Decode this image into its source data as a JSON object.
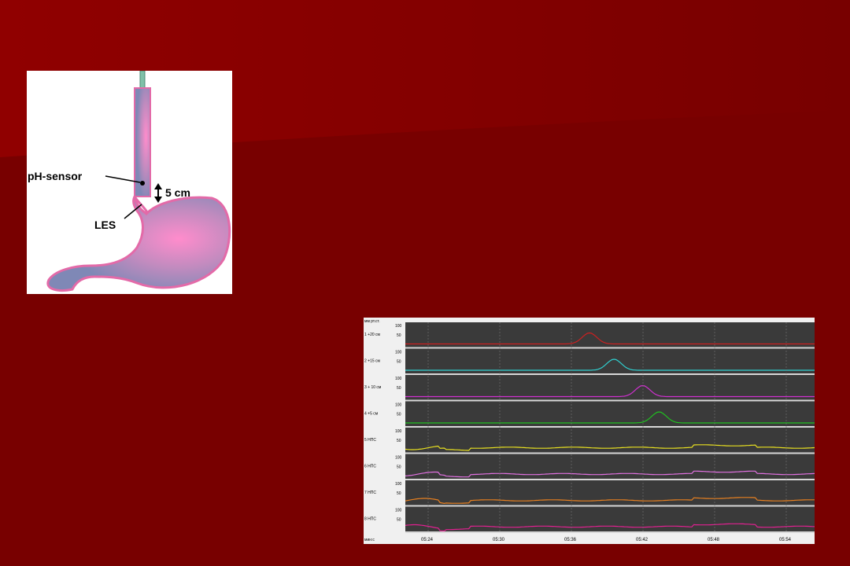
{
  "slide": {
    "background_color": "#780000",
    "highlight_color": "#8e0000"
  },
  "diagram": {
    "labels": {
      "ph_sensor": "pH-sensor",
      "distance": "5 cm",
      "les": "LES"
    },
    "colors": {
      "catheter": "#7fc0a8",
      "stomach_outline": "#e36aa8",
      "stomach_fill_center": "#ff8ccc",
      "stomach_fill_edge": "#7f88b6"
    }
  },
  "manometry": {
    "unit_label": "мм рт.ст.",
    "time_unit_label": "мин:с",
    "channel_scale": [
      "100",
      "50"
    ],
    "time_ticks": [
      "05:24",
      "05:30",
      "05:36",
      "05:42",
      "05:48",
      "05:54"
    ],
    "channels": [
      {
        "label": "1 +20 см",
        "color": "#cc2020"
      },
      {
        "label": "2 +15 см",
        "color": "#30d0d0"
      },
      {
        "label": "3 + 10 см",
        "color": "#d030d0"
      },
      {
        "label": "4 +5 см",
        "color": "#20c020"
      },
      {
        "label": "5 НПС",
        "color": "#e8e020"
      },
      {
        "label": "6 НПС",
        "color": "#e070e0"
      },
      {
        "label": "7 НПС",
        "color": "#e88020"
      },
      {
        "label": "8 НПС",
        "color": "#e02090"
      }
    ]
  }
}
